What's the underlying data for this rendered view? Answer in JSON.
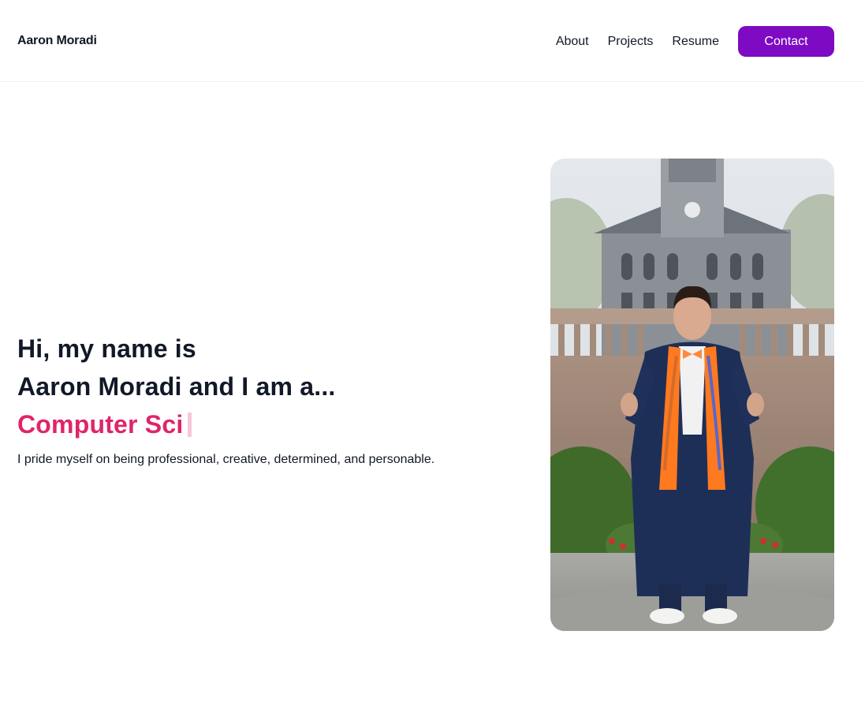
{
  "header": {
    "brand": "Aaron Moradi",
    "nav": [
      {
        "label": "About"
      },
      {
        "label": "Projects"
      },
      {
        "label": "Resume"
      }
    ],
    "contact_label": "Contact",
    "accent_color": "#7e0ac4"
  },
  "hero": {
    "line1": "Hi, my name is",
    "line2": "Aaron Moradi and I am a...",
    "typed_text": "Computer Sci",
    "typed_color": "#e0246b",
    "tagline": "I pride myself on being professional, creative, determined, and personable."
  },
  "photo": {
    "description_icon": "graduation-portrait-photo"
  }
}
